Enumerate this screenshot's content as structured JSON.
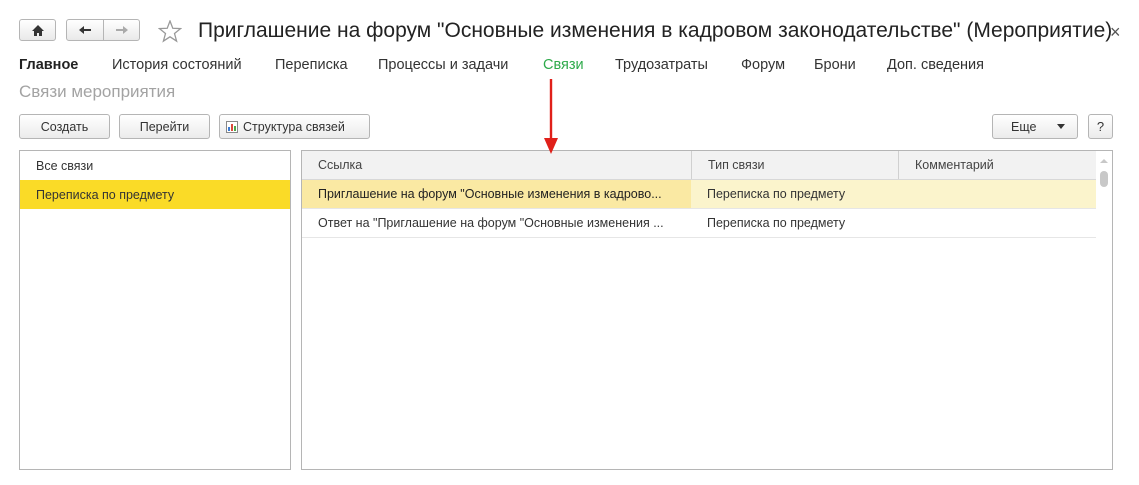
{
  "window": {
    "title": "Приглашение на форум \"Основные изменения в кадровом законодательстве\" (Мероприятие)",
    "close": "×"
  },
  "tabs": [
    "Главное",
    "История состояний",
    "Переписка",
    "Процессы и задачи",
    "Связи",
    "Трудозатраты",
    "Форум",
    "Брони",
    "Доп. сведения"
  ],
  "section_title": "Связи мероприятия",
  "toolbar": {
    "create_label": "Создать",
    "goto_label": "Перейти",
    "structure_label": "Структура связей",
    "more_label": "Еще",
    "help_label": "?"
  },
  "left_list": {
    "items": [
      "Все связи",
      "Переписка по предмету"
    ]
  },
  "grid": {
    "headers": [
      "Ссылка",
      "Тип связи",
      "Комментарий"
    ],
    "rows": [
      [
        "Приглашение на форум \"Основные изменения в кадрово...",
        "Переписка по предмету",
        ""
      ],
      [
        "Ответ на \"Приглашение на форум \"Основные изменения ...",
        "Переписка по предмету",
        ""
      ]
    ]
  },
  "colors": {
    "active_tab": "#2eaa4b",
    "selection": "#fadb27",
    "arrow": "#e0201a"
  }
}
